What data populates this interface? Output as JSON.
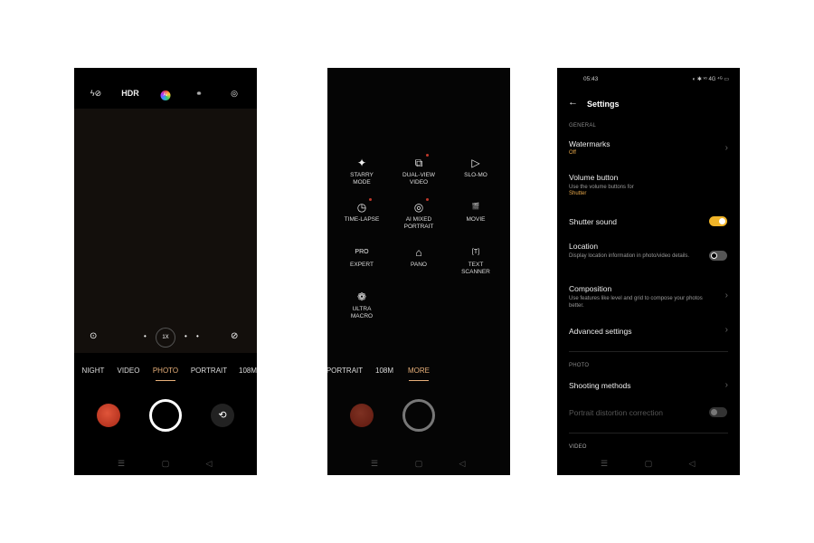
{
  "camera": {
    "top": {
      "flash": "ϟ⊘",
      "hdr": "HDR",
      "ai": "AI",
      "filter": "filter-icon",
      "settings": "settings-icon"
    },
    "zoom": "1X",
    "modes": [
      "NIGHT",
      "VIDEO",
      "PHOTO",
      "PORTRAIT",
      "108M"
    ],
    "active_mode": "PHOTO"
  },
  "more": {
    "modes": [
      {
        "label": "STARRY MODE",
        "icon": "✦",
        "dot": false
      },
      {
        "label": "DUAL-VIEW VIDEO",
        "icon": "⧉",
        "dot": true
      },
      {
        "label": "SLO-MO",
        "icon": "▷",
        "dot": false
      },
      {
        "label": "TIME-LAPSE",
        "icon": "◷",
        "dot": true
      },
      {
        "label": "AI MIXED PORTRAIT",
        "icon": "◎",
        "dot": true
      },
      {
        "label": "MOVIE",
        "icon": "🎬",
        "dot": false
      },
      {
        "label": "EXPERT",
        "icon": "PRO",
        "dot": false
      },
      {
        "label": "PANO",
        "icon": "⌂",
        "dot": false
      },
      {
        "label": "TEXT SCANNER",
        "icon": "[T]",
        "dot": false
      },
      {
        "label": "ULTRA MACRO",
        "icon": "❁",
        "dot": false
      }
    ],
    "bar": [
      "PORTRAIT",
      "108M",
      "MORE"
    ],
    "active": "MORE"
  },
  "settings": {
    "time": "05:43",
    "status": "◐ ✱ ᵛᵒ 4G ⁴ᴳ ▭",
    "title": "Settings",
    "general": "GENERAL",
    "watermarks": "Watermarks",
    "watermarks_value": "Off",
    "volume": "Volume button",
    "volume_desc": "Use the volume buttons for",
    "volume_value": "Shutter",
    "shutter_sound": "Shutter sound",
    "shutter_sound_on": true,
    "location": "Location",
    "location_desc": "Display location information in photo/video details.",
    "location_on": false,
    "composition": "Composition",
    "composition_desc": "Use features like level and grid to compose your photos better.",
    "advanced": "Advanced settings",
    "photo": "PHOTO",
    "shooting": "Shooting methods",
    "portrait_distortion": "Portrait distortion correction",
    "portrait_distortion_on": false,
    "video": "VIDEO"
  },
  "nav": {
    "menu": "☰",
    "home": "▢",
    "back": "◁"
  },
  "colors": {
    "accent": "#e8b07a",
    "toggle_on": "#f0b428"
  }
}
